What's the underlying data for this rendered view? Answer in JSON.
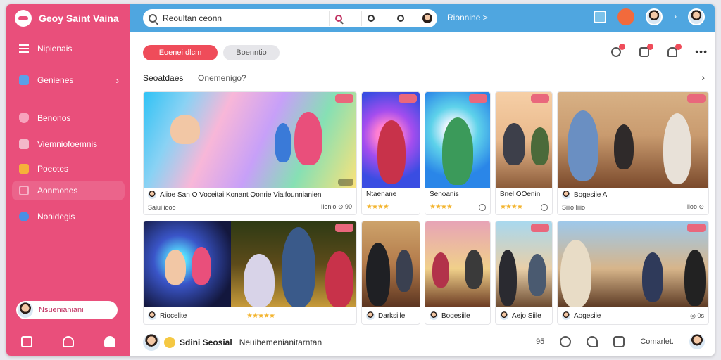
{
  "brand": {
    "name": "Geoy Saint Vaina",
    "accent": "#e94f7b"
  },
  "sidebar": {
    "items": [
      {
        "label": "Nipienais",
        "icon": "menu-icon"
      },
      {
        "label": "Genienes",
        "icon": "puzzle-icon",
        "has_chevron": true
      },
      {
        "label": "Benonos",
        "icon": "heart-icon"
      },
      {
        "label": "Viemniofoemnis",
        "icon": "message-icon"
      },
      {
        "label": "Poeotes",
        "icon": "star-icon"
      },
      {
        "label": "Aonmones",
        "icon": "box-icon"
      },
      {
        "label": "Noaidegis",
        "icon": "globe-icon"
      }
    ],
    "user": {
      "name": "Nsuenianiani"
    },
    "bottom_icons": [
      "grid-icon",
      "people-icon",
      "person-icon"
    ]
  },
  "topbar": {
    "search_value": "Reoultan ceonn",
    "link": "Rionnine >",
    "color": "#4fa6e0"
  },
  "main": {
    "tabs": [
      {
        "label": "Eoenei dlcm"
      },
      {
        "label": "Boenntio"
      }
    ],
    "section_title": "Seoatdaes",
    "section_sub": "Onemenigo?",
    "cards": [
      {
        "title": "Aiioe San O Voceitai Konant Qonrie Viaifounnianieni",
        "sub": "Saiui iooo",
        "count": "Iienio ⊙ 90",
        "stars": ""
      },
      {
        "title": "Ntaenane",
        "sub": "",
        "count": "",
        "stars": "★★★★"
      },
      {
        "title": "Senoanis",
        "sub": "",
        "count": "",
        "stars": "★★★★"
      },
      {
        "title": "Bnel OOenin",
        "sub": "",
        "count": "",
        "stars": "★★★★"
      },
      {
        "title": "Bogesiie A",
        "sub": "Siiio Iiiio",
        "count": "iioo ⊙",
        "stars": ""
      },
      {
        "title": "Riocelite",
        "sub": "",
        "count": "",
        "stars": "★★★★★"
      },
      {
        "title": "Darksiile",
        "sub": "",
        "count": "",
        "stars": ""
      },
      {
        "title": "Bogesiile",
        "sub": "",
        "count": "",
        "stars": ""
      },
      {
        "title": "Aejo Siile",
        "sub": "",
        "count": "",
        "stars": ""
      },
      {
        "title": "Aogesiie",
        "sub": "",
        "count": "◎ 0s",
        "stars": ""
      }
    ]
  },
  "bottombar": {
    "name": "Sdini Seosial",
    "text": "Neuihemenianitarntan",
    "count": "95",
    "link": "Comarlet."
  }
}
